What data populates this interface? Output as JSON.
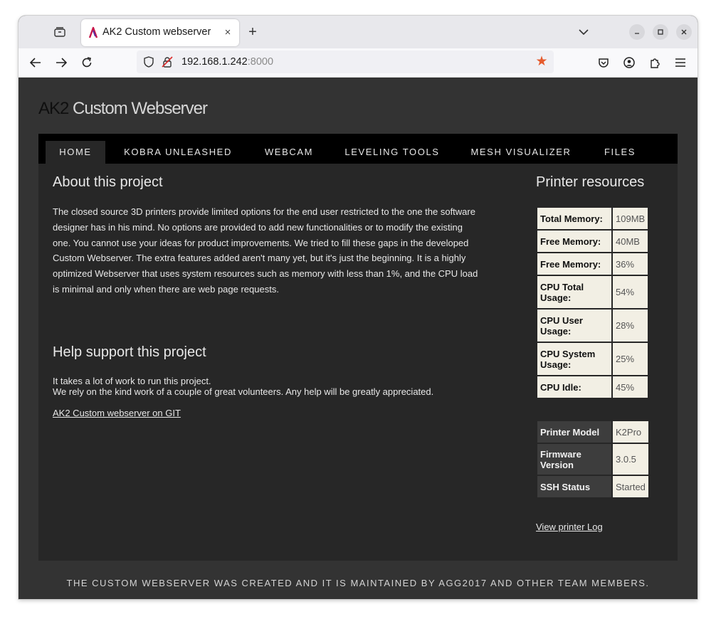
{
  "browser": {
    "tab_title": "AK2 Custom webserver",
    "tab_close_glyph": "×",
    "new_tab_glyph": "+",
    "url_host": "192.168.1.242",
    "url_port": ":8000",
    "icons": [
      "tabs-overview-icon",
      "favicon-icon",
      "close-icon",
      "plus-icon",
      "chevron-down-icon",
      "minimize-icon",
      "maximize-icon",
      "window-close-icon",
      "back-arrow-icon",
      "forward-arrow-icon",
      "reload-icon",
      "shield-icon",
      "insecure-lock-icon",
      "bookmark-star-icon",
      "pocket-icon",
      "account-icon",
      "extensions-icon",
      "menu-icon"
    ],
    "star_color": "#e55b2d"
  },
  "site": {
    "title_ak2": "AK2",
    "title_rest": " Custom Webserver",
    "nav": [
      "HOME",
      "KOBRA UNLEASHED",
      "WEBCAM",
      "LEVELING TOOLS",
      "MESH VISUALIZER",
      "FILES"
    ],
    "active_nav": "HOME"
  },
  "about": {
    "heading": "About this project",
    "text": "The closed source 3D printers provide limited options for the end user restricted to the one the software designer has in his mind. No options are provided to add new functionalities or to modify the existing one. You cannot use your ideas for product improvements. We tried to fill these gaps in the developed Custom Webserver. The extra features added aren't many yet, but it's just the beginning. It is a highly optimized Webserver that uses system resources such as memory with less than 1%, and the CPU load is minimal and only when there are web page requests."
  },
  "help": {
    "heading": "Help support this project",
    "line1": "It takes a lot of work to run this project.",
    "line2": "We rely on the kind work of a couple of great volunteers. Any help will be greatly appreciated.",
    "git_link": "AK2 Custom webserver on GIT"
  },
  "resources": {
    "heading": "Printer resources",
    "rows": [
      {
        "label": "Total Memory:",
        "value": "109MB"
      },
      {
        "label": "Free Memory:",
        "value": "40MB"
      },
      {
        "label": "Free Memory:",
        "value": "36%"
      },
      {
        "label": "CPU Total Usage:",
        "value": "54%"
      },
      {
        "label": "CPU User Usage:",
        "value": "28%"
      },
      {
        "label": "CPU System Usage:",
        "value": "25%"
      },
      {
        "label": "CPU Idle:",
        "value": "45%"
      }
    ]
  },
  "printer_info": {
    "rows": [
      {
        "label": "Printer Model",
        "value": "K2Pro"
      },
      {
        "label": "Firmware Version",
        "value": "3.0.5"
      },
      {
        "label": "SSH Status",
        "value": "Started"
      }
    ],
    "log_link": "View printer Log"
  },
  "footer": {
    "text": "THE CUSTOM WEBSERVER WAS CREATED AND IT IS MAINTAINED BY AGG2017 AND OTHER TEAM MEMBERS."
  }
}
